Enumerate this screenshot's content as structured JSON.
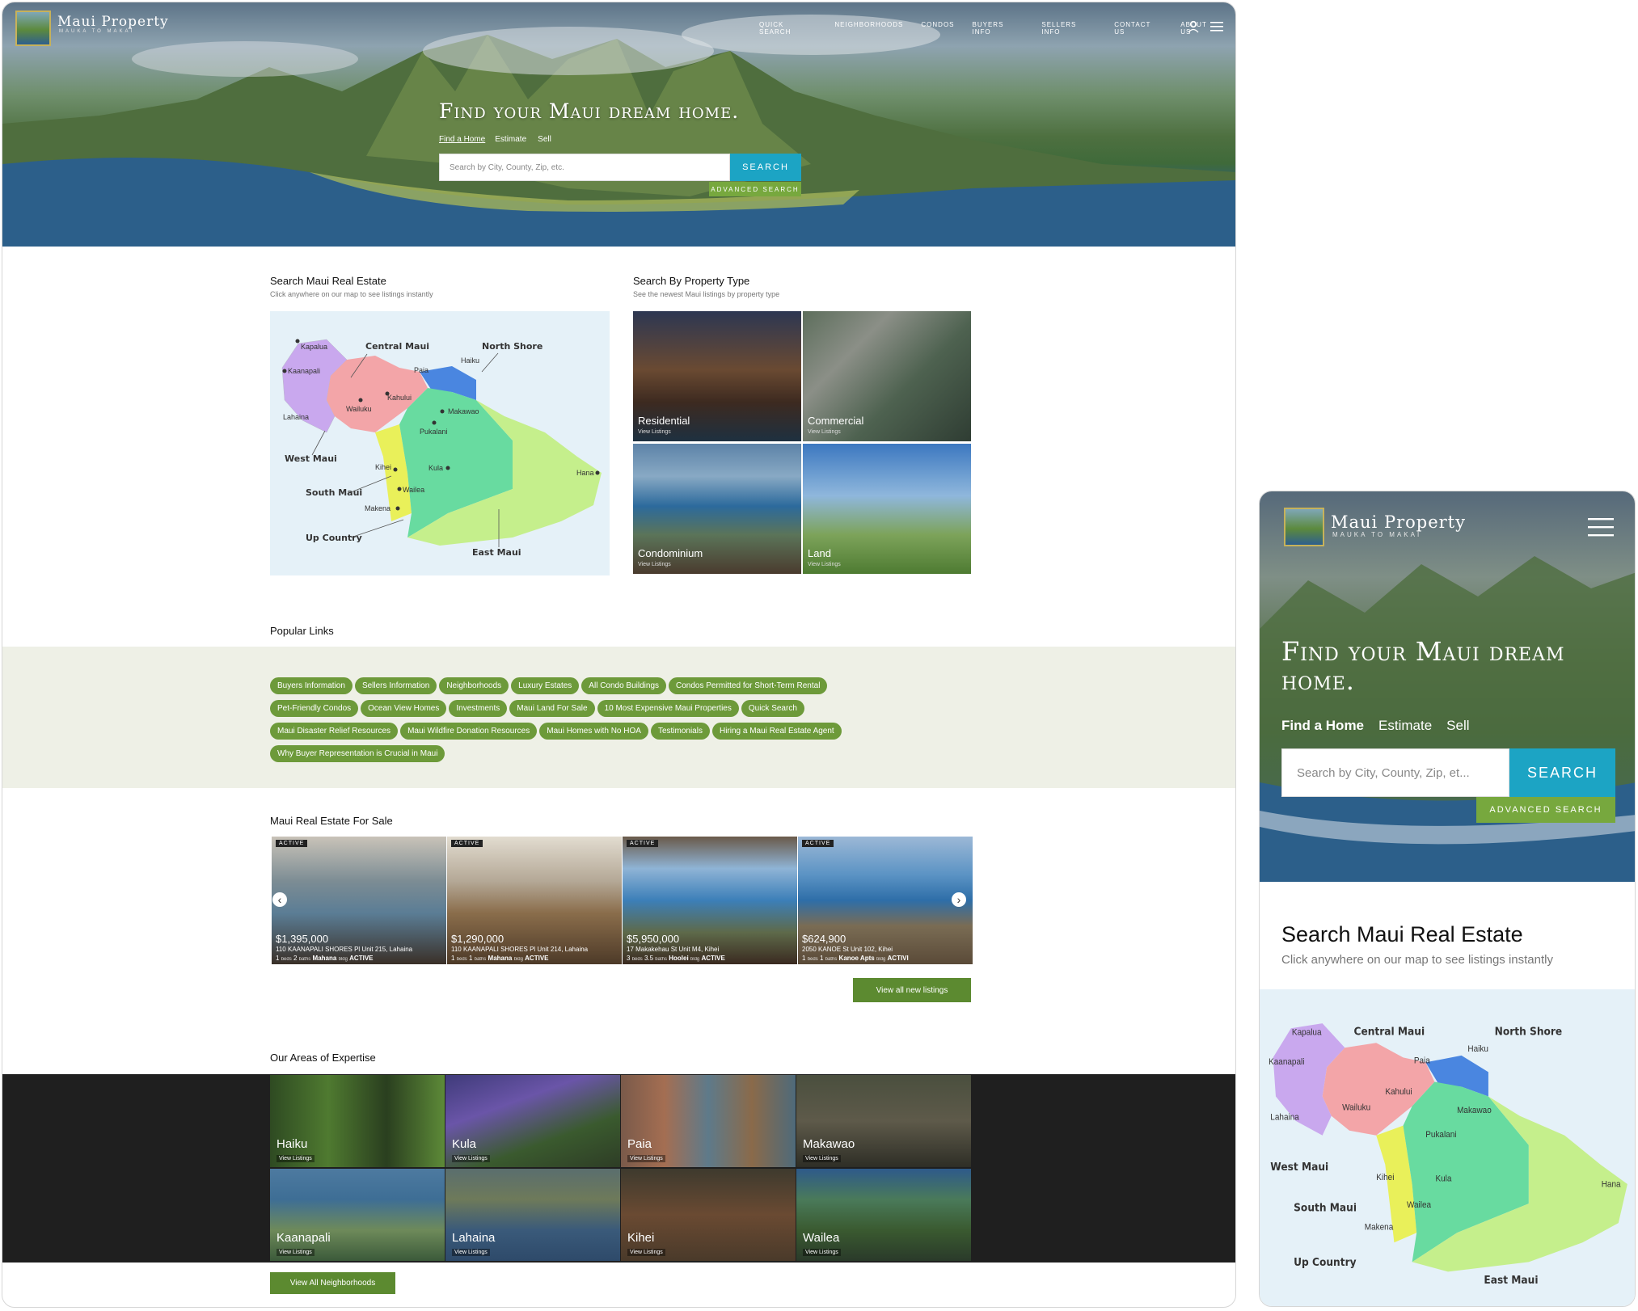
{
  "brand": {
    "name": "Maui Property",
    "tagline": "Mauka to Makai"
  },
  "nav": [
    "Quick Search",
    "Neighborhoods",
    "Condos",
    "Buyers Info",
    "Sellers Info",
    "Contact Us",
    "About Us"
  ],
  "hero": {
    "title": "Find your Maui dream home.",
    "mobile_title": "Find your Maui dream home.",
    "tabs": [
      "Find a Home",
      "Estimate",
      "Sell"
    ],
    "search_placeholder": "Search by City, County, Zip, etc.",
    "mobile_search_placeholder": "Search by City, County, Zip, et...",
    "search_label": "Search",
    "advanced_label": "Advanced Search"
  },
  "map_section": {
    "title": "Search Maui Real Estate",
    "subtitle": "Click anywhere on our map to see listings instantly",
    "regions": [
      "Central Maui",
      "North Shore",
      "West Maui",
      "South Maui",
      "Up Country",
      "East Maui"
    ],
    "towns": [
      "Kapalua",
      "Kaanapali",
      "Lahaina",
      "Paia",
      "Haiku",
      "Kahului",
      "Wailuku",
      "Makawao",
      "Pukalani",
      "Kihei",
      "Wailea",
      "Makena",
      "Kula",
      "Hana"
    ],
    "colors": {
      "west": "#c9a8ee",
      "central": "#f3a5a8",
      "north": "#4a86e0",
      "south": "#e9f05a",
      "upcountry": "#68dba0",
      "east": "#c5ef8c",
      "water": "#e5f1f8"
    }
  },
  "property_types": {
    "title": "Search By Property Type",
    "subtitle": "See the newest Maui listings by property type",
    "items": [
      {
        "name": "Residential",
        "sub": "View Listings"
      },
      {
        "name": "Commercial",
        "sub": "View Listings"
      },
      {
        "name": "Condominium",
        "sub": "View Listings"
      },
      {
        "name": "Land",
        "sub": "View Listings"
      }
    ]
  },
  "popular_links": {
    "title": "Popular Links",
    "items": [
      "Buyers Information",
      "Sellers Information",
      "Neighborhoods",
      "Luxury Estates",
      "All Condo Buildings",
      "Condos Permitted for Short-Term Rental",
      "Pet-Friendly Condos",
      "Ocean View Homes",
      "Investments",
      "Maui Land For Sale",
      "10 Most Expensive Maui Properties",
      "Quick Search",
      "Maui Disaster Relief Resources",
      "Maui Wildfire Donation Resources",
      "Maui Homes with No HOA",
      "Testimonials",
      "Hiring a Maui Real Estate Agent",
      "Why Buyer Representation is Crucial in Maui"
    ]
  },
  "listings": {
    "title": "Maui Real Estate For Sale",
    "view_all": "View all new listings",
    "items": [
      {
        "badge": "ACTIVE",
        "price": "$1,395,000",
        "address": "110 KAANAPALI SHORES Pl Unit 215, Lahaina",
        "beds": "1",
        "baths": "2",
        "bldg": "Mahana",
        "status": "ACTIVE"
      },
      {
        "badge": "ACTIVE",
        "price": "$1,290,000",
        "address": "110 KAANAPALI SHORES Pl Unit 214, Lahaina",
        "beds": "1",
        "baths": "1",
        "bldg": "Mahana",
        "status": "ACTIVE"
      },
      {
        "badge": "ACTIVE",
        "price": "$5,950,000",
        "address": "17 Makakehau St Unit M4, Kihei",
        "beds": "3",
        "baths": "3.5",
        "bldg": "Hoolei",
        "status": "ACTIVE"
      },
      {
        "badge": "ACTIVE",
        "price": "$624,900",
        "address": "2050 KANOE St Unit 102, Kihei",
        "beds": "1",
        "baths": "1",
        "bldg": "Kanoe Apts",
        "status": "ACTIVI"
      }
    ],
    "labels": {
      "beds": "beds",
      "baths": "baths",
      "bldg": "bldg"
    }
  },
  "areas": {
    "title": "Our Areas of Expertise",
    "view_all": "View All Neighborhoods",
    "sub": "View Listings",
    "items": [
      "Haiku",
      "Kula",
      "Paia",
      "Makawao",
      "Kaanapali",
      "Lahaina",
      "Kihei",
      "Wailea"
    ]
  },
  "colors": {
    "accent_blue": "#1ca4c4",
    "accent_green": "#77a83e",
    "pill_green": "#6d9a3a",
    "button_green": "#5c8a30",
    "links_band": "#eef0e6",
    "areas_band": "#1f1f1f"
  }
}
